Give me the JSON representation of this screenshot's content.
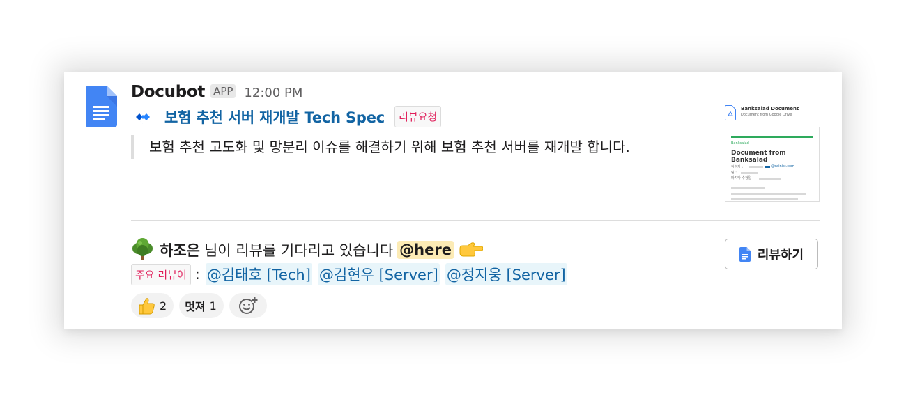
{
  "message": {
    "bot_name": "Docubot",
    "app_badge": "APP",
    "time": "12:00 PM",
    "title": "보험 추천 서버 재개발 Tech Spec",
    "title_tag": "리뷰요청",
    "description": "보험 추천 고도화 및 망분리 이슈를 해결하기 위해 보험 추천 서버를 재개발 합니다."
  },
  "preview": {
    "title": "Banksalad Document",
    "subtitle": "Document from Google Drive",
    "doc_brand": "Banksalad",
    "doc_title": "Document from Banksalad",
    "author_label": "작성자 :",
    "author_email": "@rainist.com",
    "team_label": "팀 :",
    "modified_label": "마지막 수정일 :"
  },
  "waiting": {
    "name": "하조은",
    "text": "님이 리뷰를 기다리고 있습니다",
    "here": "@here"
  },
  "reviewers": {
    "tag": "주요 리뷰어",
    "colon": ":",
    "mentions": [
      "@김태호 [Tech]",
      "@김현우 [Server]",
      "@정지웅 [Server]"
    ]
  },
  "reactions": [
    {
      "icon": "thumbs-up-icon",
      "count": "2"
    },
    {
      "emoji_text": "멋져",
      "count": "1"
    }
  ],
  "review_button": {
    "label": "리뷰하기"
  },
  "colors": {
    "link": "#1264a3",
    "tag_text": "#e01e5a",
    "here_bg": "#fcebb5",
    "mention_bg": "#e8f5fa",
    "gdocs_blue": "#4285f4"
  }
}
